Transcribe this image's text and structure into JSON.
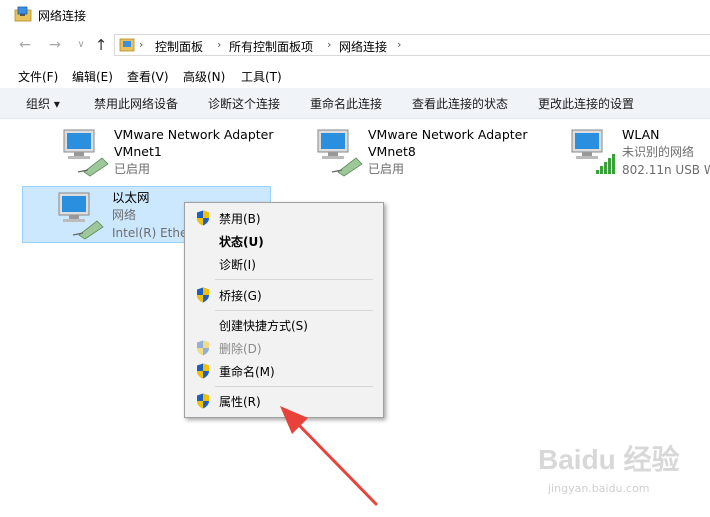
{
  "window": {
    "title": "网络连接"
  },
  "address": {
    "crumbs": [
      "控制面板",
      "所有控制面板项",
      "网络连接"
    ]
  },
  "menu": [
    "文件(F)",
    "编辑(E)",
    "查看(V)",
    "高级(N)",
    "工具(T)"
  ],
  "commands": [
    "组织 ▾",
    "禁用此网络设备",
    "诊断这个连接",
    "重命名此连接",
    "查看此连接的状态",
    "更改此连接的设置"
  ],
  "connections": [
    {
      "name": "VMware Network Adapter",
      "name2": "VMnet1",
      "status": "已启用"
    },
    {
      "name": "VMware Network Adapter",
      "name2": "VMnet8",
      "status": "已启用"
    },
    {
      "name": "WLAN",
      "status": "未识别的网络",
      "device": "802.11n USB W"
    },
    {
      "name": "以太网",
      "status": "网络",
      "device": "Intel(R) Ethe"
    }
  ],
  "context_menu": [
    {
      "label": "禁用(B)",
      "shield": true
    },
    {
      "label": "状态(U)",
      "bold": true
    },
    {
      "label": "诊断(I)"
    },
    {
      "label": "桥接(G)",
      "shield": true
    },
    {
      "label": "创建快捷方式(S)"
    },
    {
      "label": "删除(D)",
      "shield": true,
      "disabled": true
    },
    {
      "label": "重命名(M)",
      "shield": true
    },
    {
      "label": "属性(R)",
      "shield": true
    }
  ],
  "watermark": {
    "brand": "Baidu 经验",
    "url": "jingyan.baidu.com"
  },
  "colors": {
    "selection": "#cce8ff",
    "arrow": "#e8423a",
    "shield_blue": "#1f5fbf",
    "shield_yellow": "#f2c200"
  }
}
